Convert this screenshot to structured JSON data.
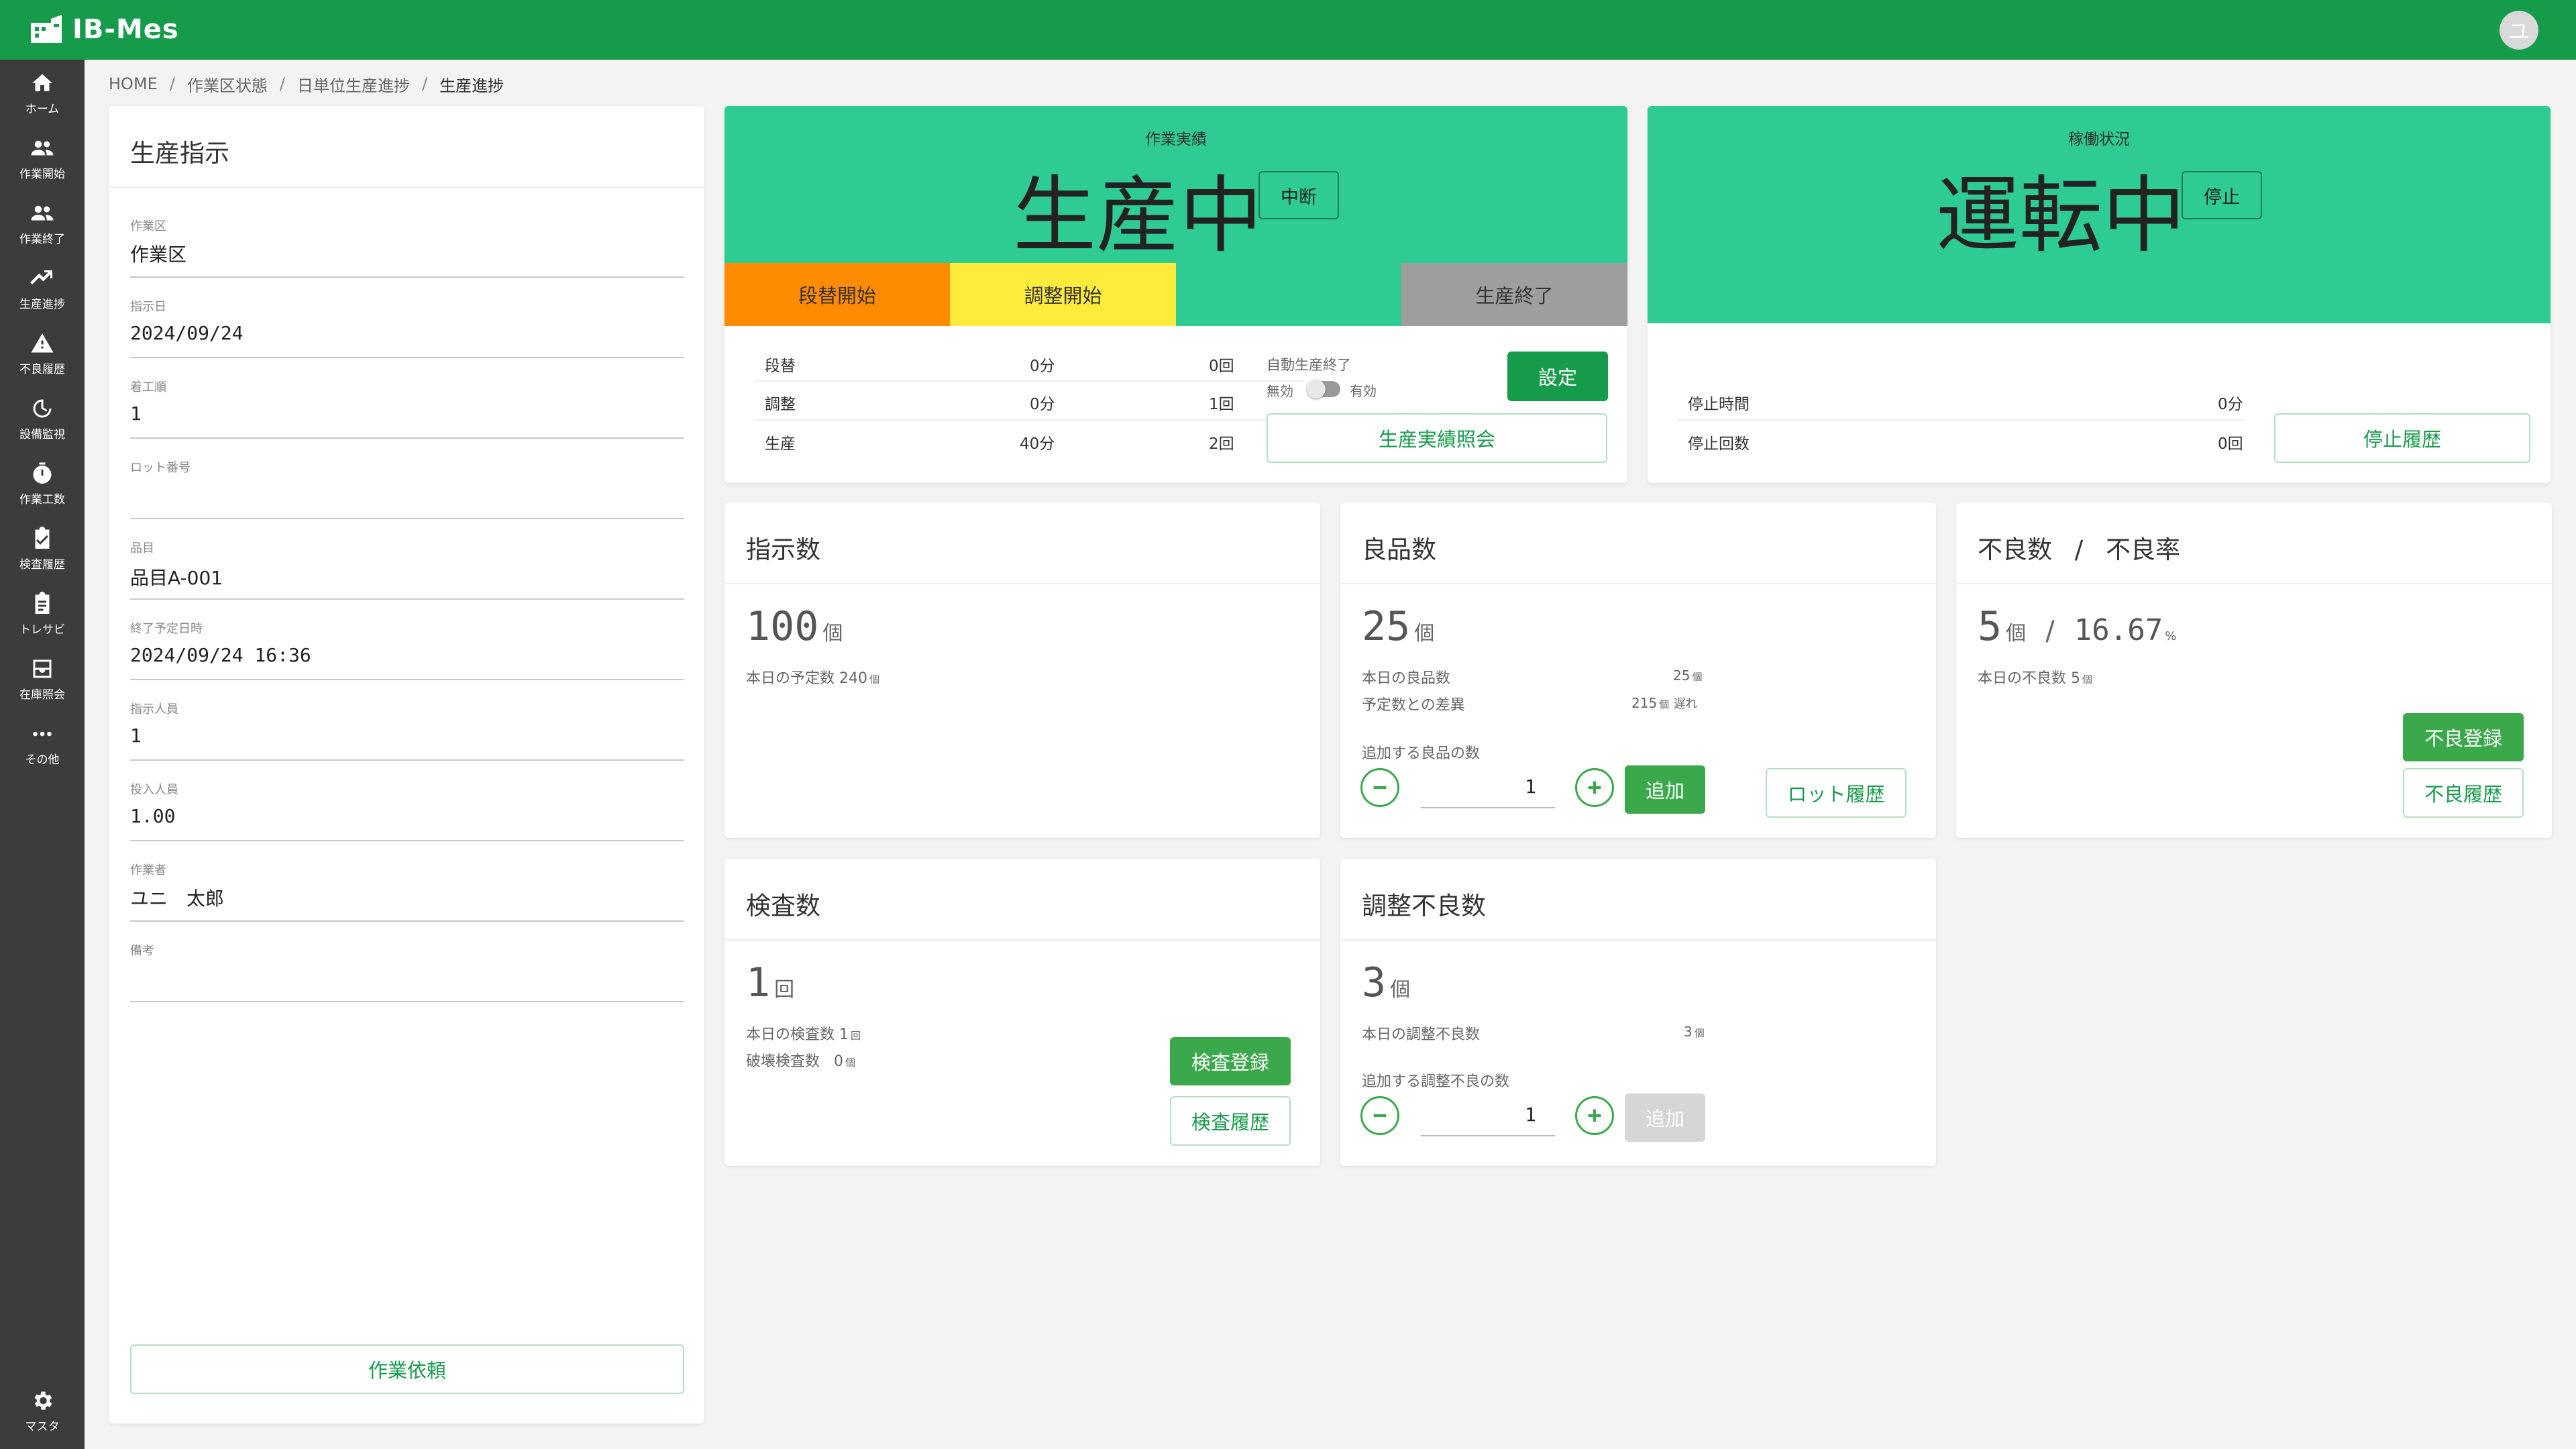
{
  "app": {
    "name": "IB-Mes",
    "avatar_initial": "ユ"
  },
  "sidebar": {
    "items": [
      {
        "label": "ホーム",
        "icon": "home-icon"
      },
      {
        "label": "作業開始",
        "icon": "people-icon"
      },
      {
        "label": "作業終了",
        "icon": "people-icon"
      },
      {
        "label": "生産進捗",
        "icon": "trending-up-icon"
      },
      {
        "label": "不良履歴",
        "icon": "warning-icon"
      },
      {
        "label": "設備監視",
        "icon": "gauge-icon"
      },
      {
        "label": "作業工数",
        "icon": "stopwatch-icon"
      },
      {
        "label": "検査履歴",
        "icon": "clipboard-check-icon"
      },
      {
        "label": "トレサビ",
        "icon": "document-icon"
      },
      {
        "label": "在庫照会",
        "icon": "inbox-icon"
      },
      {
        "label": "その他",
        "icon": "more-icon"
      }
    ],
    "master": {
      "label": "マスタ",
      "icon": "gear-icon"
    }
  },
  "breadcrumb": [
    "HOME",
    "作業区状態",
    "日単位生産進捗",
    "生産進捗"
  ],
  "instruction": {
    "title": "生産指示",
    "fields": [
      {
        "label": "作業区",
        "value": "作業区"
      },
      {
        "label": "指示日",
        "value": "2024/09/24"
      },
      {
        "label": "着工順",
        "value": "1"
      },
      {
        "label": "ロット番号",
        "value": ""
      },
      {
        "label": "品目",
        "value": "品目A-001"
      },
      {
        "label": "終了予定日時",
        "value": "2024/09/24 16:36"
      },
      {
        "label": "指示人員",
        "value": "1"
      },
      {
        "label": "投入人員",
        "value": "1.00"
      },
      {
        "label": "作業者",
        "value": "ユニ　太郎"
      },
      {
        "label": "備考",
        "value": ""
      }
    ],
    "request_button": "作業依頼"
  },
  "work_result": {
    "caption": "作業実績",
    "status": "生産中",
    "interrupt_button": "中断",
    "buttons": {
      "changeover": "段替開始",
      "adjust": "調整開始",
      "blank": "",
      "end": "生産終了"
    },
    "button_colors": {
      "changeover": "#ff8c00",
      "adjust": "#ffeb3b",
      "blank": "#2ecc93",
      "end": "#9e9e9e"
    },
    "rows": [
      {
        "label": "段替",
        "time": "0分",
        "count": "0回"
      },
      {
        "label": "調整",
        "time": "0分",
        "count": "1回"
      },
      {
        "label": "生産",
        "time": "40分",
        "count": "2回"
      }
    ],
    "auto_end_label": "自動生産終了",
    "toggle_off": "無効",
    "toggle_on": "有効",
    "setting_button": "設定",
    "inquiry_button": "生産実績照会"
  },
  "operation": {
    "caption": "稼働状況",
    "status": "運転中",
    "stop_button": "停止",
    "rows": [
      {
        "label": "停止時間",
        "value": "0分"
      },
      {
        "label": "停止回数",
        "value": "0回"
      }
    ],
    "history_button": "停止履歴"
  },
  "instructed_qty": {
    "title": "指示数",
    "value": "100",
    "unit": "個",
    "today_label": "本日の予定数",
    "today_value": "240",
    "today_unit": "個"
  },
  "good_qty": {
    "title": "良品数",
    "value": "25",
    "unit": "個",
    "today_label": "本日の良品数",
    "today_value": "25",
    "today_unit": "個",
    "diff_label": "予定数との差異",
    "diff_value": "215",
    "diff_unit": "個",
    "diff_status": "遅れ",
    "add_label": "追加する良品の数",
    "add_value": "1",
    "add_button": "追加",
    "lot_button": "ロット履歴"
  },
  "defect": {
    "title": "不良数",
    "title_sep": "/",
    "title2": "不良率",
    "value": "5",
    "unit": "個",
    "sep": "/",
    "rate": "16.67",
    "rate_unit": "%",
    "today_label": "本日の不良数",
    "today_value": "5",
    "today_unit": "個",
    "register_button": "不良登録",
    "history_button": "不良履歴"
  },
  "inspection": {
    "title": "検査数",
    "value": "1",
    "unit": "回",
    "today_label": "本日の検査数",
    "today_value": "1",
    "today_unit": "回",
    "destructive_label": "破壊検査数",
    "destructive_value": "0",
    "destructive_unit": "個",
    "register_button": "検査登録",
    "history_button": "検査履歴"
  },
  "adjust_defect": {
    "title": "調整不良数",
    "value": "3",
    "unit": "個",
    "today_label": "本日の調整不良数",
    "today_value": "3",
    "today_unit": "個",
    "add_label": "追加する調整不良の数",
    "add_value": "1",
    "add_button": "追加"
  }
}
